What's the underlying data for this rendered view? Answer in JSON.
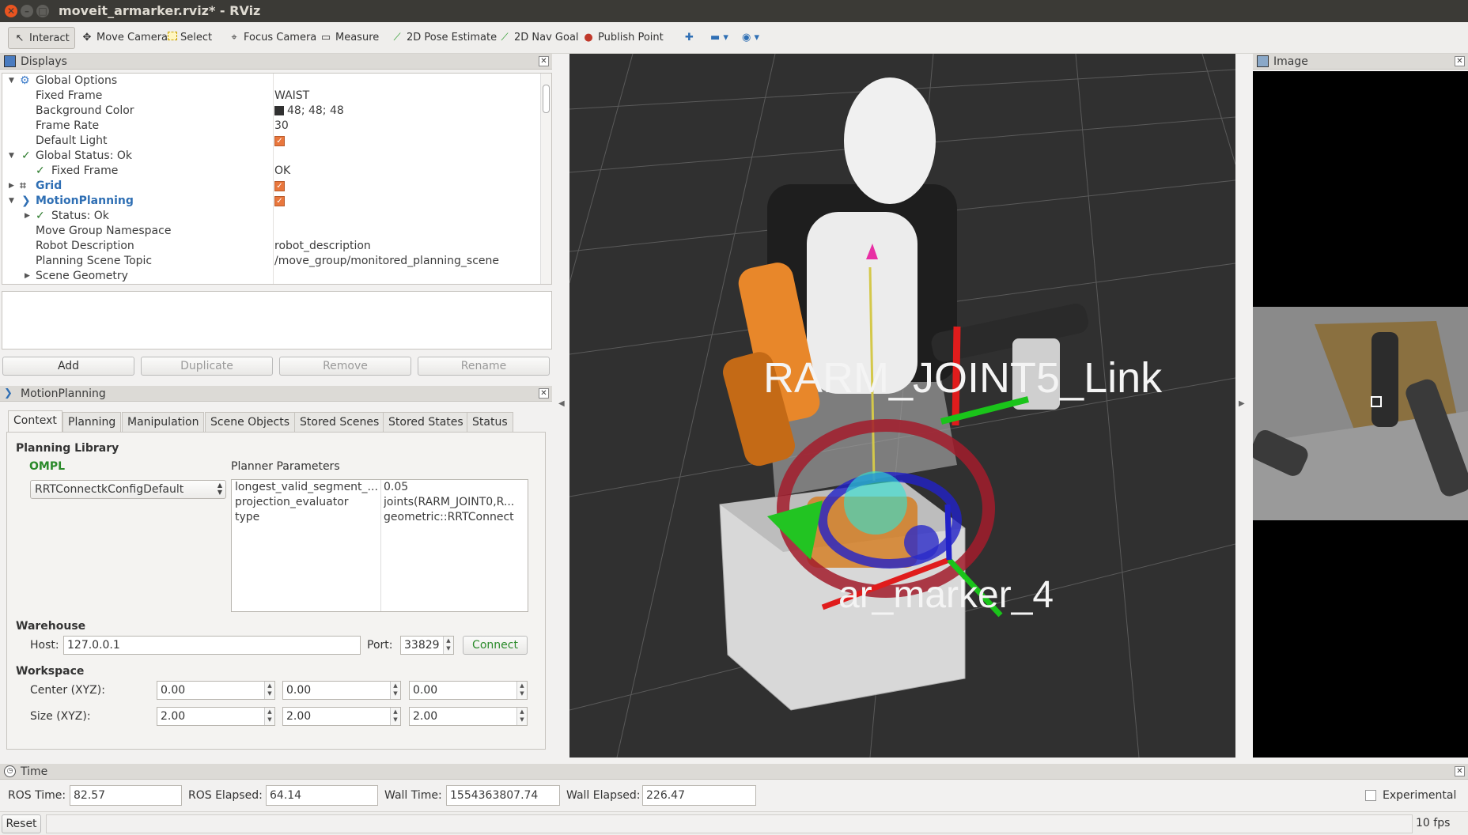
{
  "window": {
    "title": "moveit_armarker.rviz* - RViz"
  },
  "toolbar": {
    "interact": "Interact",
    "move_camera": "Move Camera",
    "select": "Select",
    "focus_camera": "Focus Camera",
    "measure": "Measure",
    "pose_estimate": "2D Pose Estimate",
    "nav_goal": "2D Nav Goal",
    "publish_point": "Publish Point"
  },
  "displays": {
    "title": "Displays",
    "rows": [
      {
        "name": "Global Options",
        "value": ""
      },
      {
        "name": "Fixed Frame",
        "value": "WAIST"
      },
      {
        "name": "Background Color",
        "value": "48; 48; 48"
      },
      {
        "name": "Frame Rate",
        "value": "30"
      },
      {
        "name": "Default Light",
        "value": ""
      },
      {
        "name": "Global Status: Ok",
        "value": ""
      },
      {
        "name": "Fixed Frame",
        "value": "OK"
      },
      {
        "name": "Grid",
        "value": ""
      },
      {
        "name": "MotionPlanning",
        "value": ""
      },
      {
        "name": "Status: Ok",
        "value": ""
      },
      {
        "name": "Move Group Namespace",
        "value": ""
      },
      {
        "name": "Robot Description",
        "value": "robot_description"
      },
      {
        "name": "Planning Scene Topic",
        "value": "/move_group/monitored_planning_scene"
      },
      {
        "name": "Scene Geometry",
        "value": ""
      }
    ],
    "buttons": {
      "add": "Add",
      "duplicate": "Duplicate",
      "remove": "Remove",
      "rename": "Rename"
    }
  },
  "motion_planning": {
    "title": "MotionPlanning",
    "tabs": [
      "Context",
      "Planning",
      "Manipulation",
      "Scene Objects",
      "Stored Scenes",
      "Stored States",
      "Status"
    ],
    "planning_library": "Planning Library",
    "library_name": "OMPL",
    "planner": "RRTConnectkConfigDefault",
    "planner_parameters_label": "Planner Parameters",
    "params": [
      {
        "key": "longest_valid_segment_...",
        "value": "0.05"
      },
      {
        "key": "projection_evaluator",
        "value": "joints(RARM_JOINT0,R..."
      },
      {
        "key": "type",
        "value": "geometric::RRTConnect"
      }
    ],
    "warehouse": {
      "label": "Warehouse",
      "host_label": "Host:",
      "host": "127.0.0.1",
      "port_label": "Port:",
      "port": "33829",
      "connect": "Connect"
    },
    "workspace": {
      "label": "Workspace",
      "center_label": "Center (XYZ):",
      "center": [
        "0.00",
        "0.00",
        "0.00"
      ],
      "size_label": "Size (XYZ):",
      "size": [
        "2.00",
        "2.00",
        "2.00"
      ]
    }
  },
  "view3d": {
    "label_link": "RARM_JOINT5_Link",
    "label_marker": "ar_marker_4"
  },
  "image_panel": {
    "title": "Image"
  },
  "time": {
    "title": "Time",
    "ros_time_label": "ROS Time:",
    "ros_time": "82.57",
    "ros_elapsed_label": "ROS Elapsed:",
    "ros_elapsed": "64.14",
    "wall_time_label": "Wall Time:",
    "wall_time": "1554363807.74",
    "wall_elapsed_label": "Wall Elapsed:",
    "wall_elapsed": "226.47",
    "experimental": "Experimental"
  },
  "status": {
    "reset": "Reset",
    "fps": "10 fps"
  },
  "colors": {
    "accent": "#e9773d",
    "background": "#303030",
    "ok": "#2a8a2a",
    "link": "#2f6fb4"
  }
}
